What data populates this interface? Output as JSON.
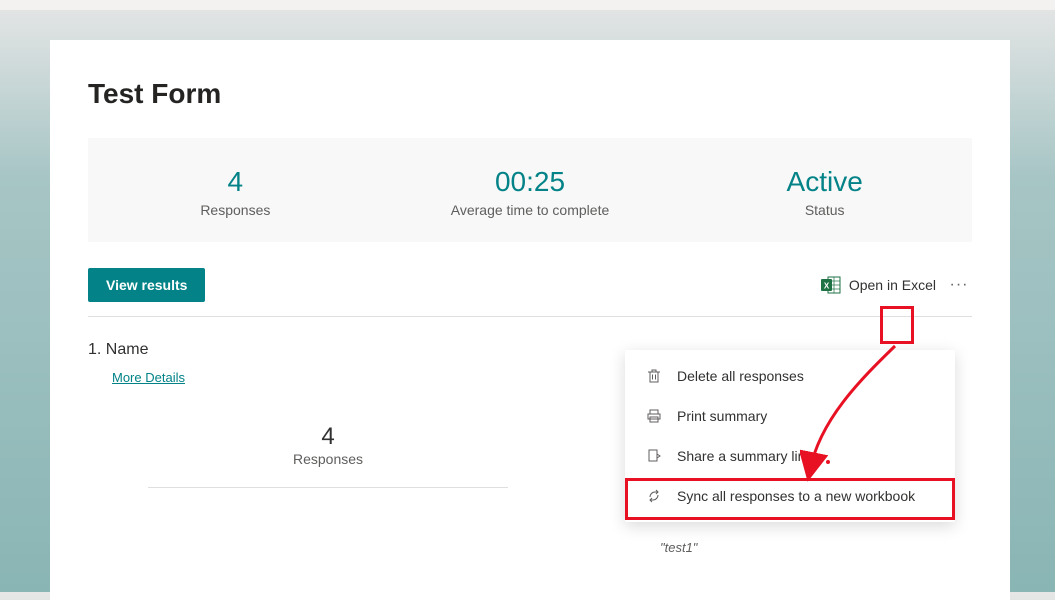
{
  "form": {
    "title": "Test Form"
  },
  "stats": {
    "responses": {
      "value": "4",
      "label": "Responses"
    },
    "avg_time": {
      "value": "00:25",
      "label": "Average time to complete"
    },
    "status": {
      "value": "Active",
      "label": "Status"
    }
  },
  "actions": {
    "view_results": "View results",
    "open_in_excel": "Open in Excel"
  },
  "menu": {
    "delete_all": "Delete all responses",
    "print_summary": "Print summary",
    "share_link": "Share a summary link",
    "sync_workbook": "Sync all responses to a new workbook"
  },
  "question": {
    "number": "1.",
    "title": "Name",
    "more_details": "More Details",
    "responses_value": "4",
    "responses_label": "Responses"
  },
  "latest_response": "\"test1\""
}
